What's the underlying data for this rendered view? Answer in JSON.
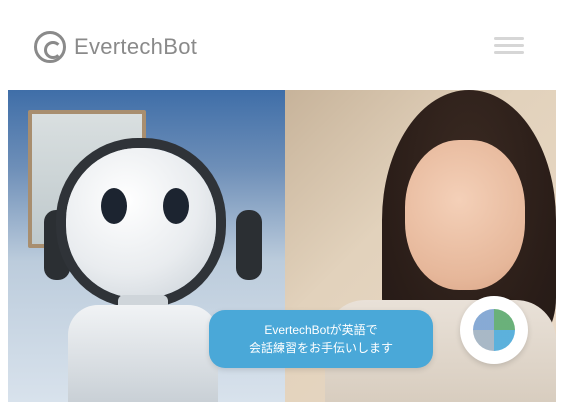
{
  "header": {
    "brand": "EvertechBot",
    "logo_icon": "evertechbot-logo-icon",
    "menu_icon": "hamburger-menu-icon"
  },
  "hero": {
    "left_image": "robot-with-headphones",
    "right_image": "smiling-woman-listening-earbuds",
    "bubble": {
      "line1": "EvertechBotが英語で",
      "line2": "会話練習をお手伝いします"
    },
    "avatar_icon": "robot-avatar-icon"
  },
  "colors": {
    "bubble_bg": "#4aa8d8",
    "brand_gray": "#8a8a8a"
  }
}
